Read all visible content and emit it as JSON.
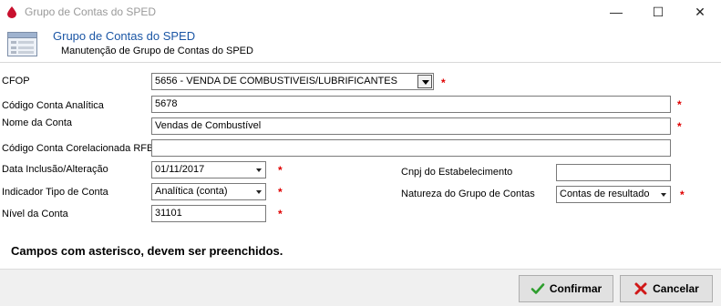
{
  "window": {
    "title": "Grupo de Contas do SPED",
    "minimize_glyph": "—",
    "maximize_glyph": "☐",
    "close_glyph": "✕"
  },
  "header": {
    "title": "Grupo de Contas do SPED",
    "subtitle": "Manutenção de Grupo de Contas do SPED",
    "icon": "form-list-icon"
  },
  "form": {
    "cfop": {
      "label": "CFOP",
      "value": "5656  - VENDA DE COMBUSTIVEIS/LUBRIFICANTES"
    },
    "codigo_conta": {
      "label": "Código Conta Analítica",
      "value": "5678"
    },
    "nome_conta": {
      "label": "Nome da Conta",
      "value": "Vendas de Combustível"
    },
    "codigo_rfb": {
      "label": "Código Conta Corelacionada RFB",
      "value": ""
    },
    "data_inclusao": {
      "label": "Data Inclusão/Alteração",
      "value": "01/11/2017"
    },
    "indicador_tipo": {
      "label": "Indicador Tipo de Conta",
      "value": "Analítica (conta)"
    },
    "nivel": {
      "label": "Nível da Conta",
      "value": "31101"
    },
    "cnpj": {
      "label": "Cnpj do Estabelecimento",
      "value": ""
    },
    "natureza": {
      "label": "Natureza do Grupo de Contas",
      "value": "Contas de resultado"
    },
    "required_marker": "*"
  },
  "notice": "Campos com asterisco, devem ser preenchidos.",
  "buttons": {
    "confirm": "Confirmar",
    "cancel": "Cancelar"
  },
  "colors": {
    "header_title": "#1b56a5",
    "required": "#e00000",
    "app_icon": "#c8102e"
  }
}
